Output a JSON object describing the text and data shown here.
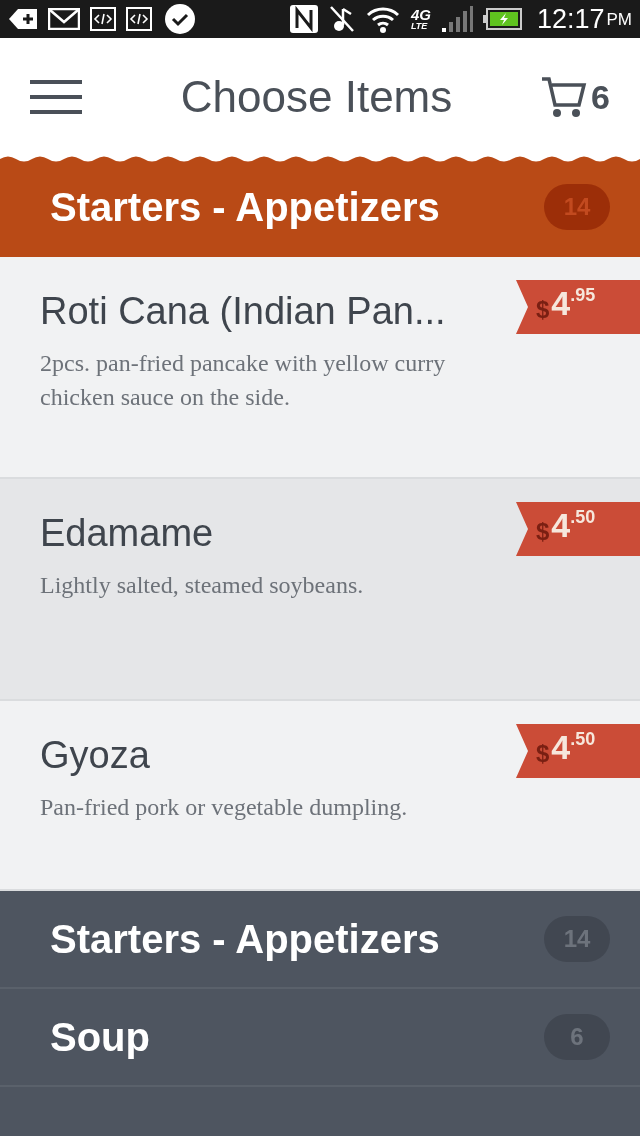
{
  "status_bar": {
    "time": "12:17",
    "meridiem": "PM",
    "network": "4G",
    "network_sub": "LTE"
  },
  "header": {
    "title": "Choose Items",
    "cart_count": "6"
  },
  "category": {
    "name": "Starters - Appetizers",
    "count": "14"
  },
  "items": [
    {
      "name": "Roti Cana (Indian Pan...",
      "description": "2pcs. pan-fried pancake with yellow curry chicken sauce on the side.",
      "currency": "$",
      "dollars": "4",
      "cents": ".95",
      "selected": false
    },
    {
      "name": "Edamame",
      "description": "Lightly salted, steamed soybeans.",
      "currency": "$",
      "dollars": "4",
      "cents": ".50",
      "selected": true
    },
    {
      "name": "Gyoza",
      "description": "Pan-fried pork or vegetable dumpling.",
      "currency": "$",
      "dollars": "4",
      "cents": ".50",
      "selected": false
    }
  ],
  "categories": [
    {
      "name": "Starters - Appetizers",
      "count": "14"
    },
    {
      "name": "Soup",
      "count": "6"
    }
  ]
}
